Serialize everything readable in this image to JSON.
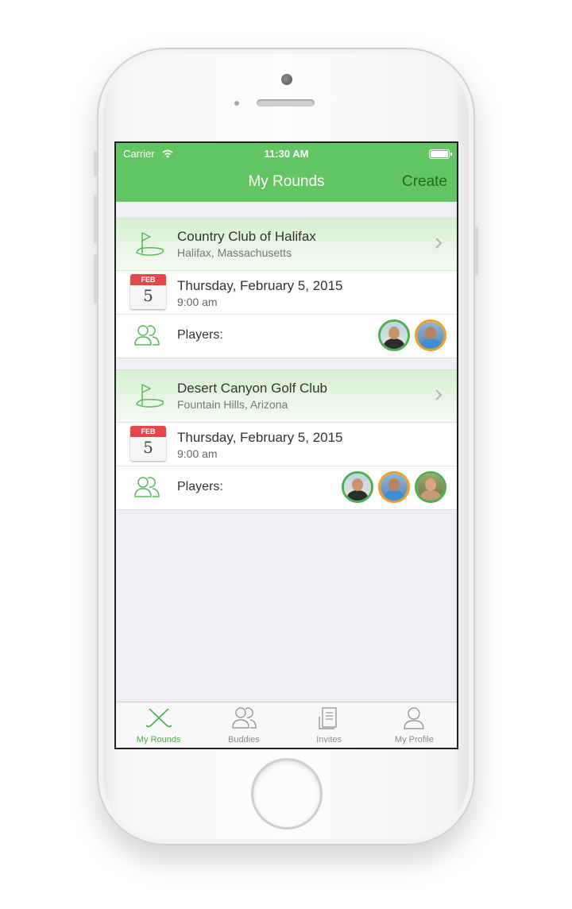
{
  "status_bar": {
    "carrier": "Carrier",
    "time": "11:30 AM"
  },
  "nav": {
    "title": "My Rounds",
    "action": "Create"
  },
  "players_label": "Players:",
  "rounds": [
    {
      "course": "Country Club of Halifax",
      "location": "Halifax, Massachusetts",
      "cal_month": "FEB",
      "cal_day": "5",
      "date": "Thursday, February 5, 2015",
      "time": "9:00 am",
      "players": [
        {
          "ring": "#4caf50"
        },
        {
          "ring": "#f0a020"
        }
      ]
    },
    {
      "course": "Desert Canyon Golf Club",
      "location": "Fountain Hills, Arizona",
      "cal_month": "FEB",
      "cal_day": "5",
      "date": "Thursday, February 5, 2015",
      "time": "9:00 am",
      "players": [
        {
          "ring": "#4caf50"
        },
        {
          "ring": "#f0a020"
        },
        {
          "ring": "#4caf50"
        }
      ]
    }
  ],
  "tabs": [
    {
      "label": "My Rounds",
      "icon": "golf-clubs-icon",
      "active": true
    },
    {
      "label": "Buddies",
      "icon": "buddies-icon",
      "active": false
    },
    {
      "label": "Invites",
      "icon": "invites-icon",
      "active": false
    },
    {
      "label": "My Profile",
      "icon": "profile-icon",
      "active": false
    }
  ],
  "colors": {
    "accent": "#62c462",
    "create": "#1b6f1b",
    "calendar": "#e34848"
  }
}
